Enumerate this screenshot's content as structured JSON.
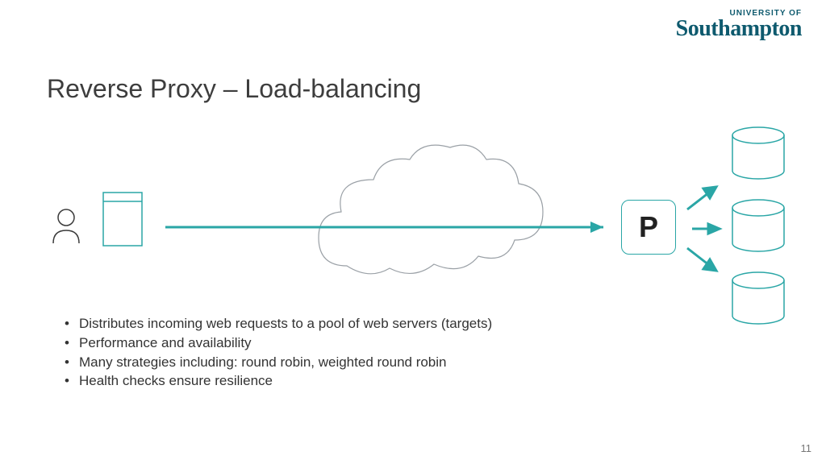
{
  "logo": {
    "small": "UNIVERSITY OF",
    "big": "Southampton"
  },
  "title": "Reverse Proxy – Load-balancing",
  "proxy_label": "P",
  "bullets": [
    "Distributes incoming web requests to a pool of web servers (targets)",
    "Performance and availability",
    "Many strategies including: round robin, weighted round robin",
    "Health checks ensure resilience"
  ],
  "page_number": "11",
  "colors": {
    "teal": "#2aa6a6",
    "outline": "#9aa0a6",
    "brand": "#0e5a6e"
  }
}
